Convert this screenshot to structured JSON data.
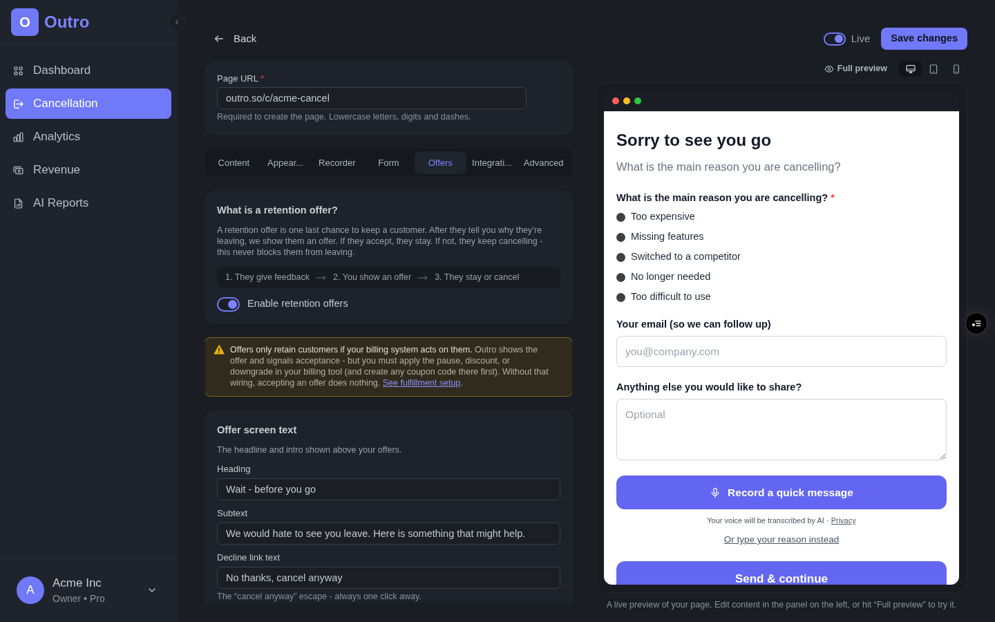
{
  "sidebar": {
    "logo": {
      "mark": "O",
      "name": "Outro"
    },
    "nav_items": [
      {
        "label": "Dashboard",
        "selected": false
      },
      {
        "label": "Cancellation",
        "selected": true
      },
      {
        "label": "Analytics",
        "selected": false
      },
      {
        "label": "Revenue",
        "selected": false
      },
      {
        "label": "AI Reports",
        "selected": false
      }
    ],
    "account": {
      "initial": "A",
      "name": "Acme Inc",
      "subtitle": "Owner • Pro"
    }
  },
  "header": {
    "back": "Back",
    "live_toggle": {
      "label": "Live",
      "on": true
    },
    "save_button": "Save changes"
  },
  "page_url": {
    "label": "Page URL",
    "required_mark": "*",
    "value": "outro.so/c/acme-cancel",
    "hint": "Required to create the page. Lowercase letters, digits and dashes."
  },
  "tabs": [
    {
      "label": "Content",
      "selected": false
    },
    {
      "label": "Appear...",
      "selected": false
    },
    {
      "label": "Recorder",
      "selected": false
    },
    {
      "label": "Form",
      "selected": false
    },
    {
      "label": "Offers",
      "selected": true
    },
    {
      "label": "Integrati...",
      "selected": false
    },
    {
      "label": "Advanced",
      "selected": false
    }
  ],
  "retention_info": {
    "title": "What is a retention offer?",
    "text": "A retention offer is one last chance to keep a customer. After they tell you why they’re leaving, we show them an offer. If they accept, they stay. If not, they keep cancelling - this never blocks them from leaving.",
    "steps": [
      "1. They give feedback",
      "2. You show an offer",
      "3. They stay or cancel"
    ],
    "toggle": {
      "label": "Enable retention offers",
      "on": true
    }
  },
  "warning": {
    "text": "**Offers only retain customers if your billing system acts on them.** Outro shows the offer and signals acceptance - but you must apply the pause, discount, or downgrade in your billing tool (and create any coupon code there first). Without that wiring, accepting an offer does nothing.",
    "link": "See fulfillment setup",
    "text_after": "."
  },
  "offer_screen_text": {
    "title": "Offer screen text",
    "description": "The headline and intro shown above your offers.",
    "fields": [
      {
        "label": "Heading",
        "value": "Wait - before you go"
      },
      {
        "label": "Subtext",
        "value": "We would hate to see you leave. Here is something that might help."
      },
      {
        "label": "Decline link text",
        "value": "No thanks, cancel anyway",
        "hint": "The “cancel anyway” escape - always one click away."
      }
    ]
  },
  "preview": {
    "full_preview": "Full preview",
    "devices": [
      {
        "selected": true
      },
      {
        "selected": false
      },
      {
        "selected": false
      }
    ],
    "page": {
      "title": "Sorry to see you go",
      "subtitle": "What is the main reason you are cancelling?",
      "question": {
        "label": "What is the main reason you are cancelling?",
        "required_mark": "*",
        "options": [
          {
            "label": "Too expensive",
            "selected": false
          },
          {
            "label": "Missing features",
            "selected": false
          },
          {
            "label": "Switched to a competitor",
            "selected": false
          },
          {
            "label": "No longer needed",
            "selected": false
          },
          {
            "label": "Too difficult to use",
            "selected": false
          }
        ]
      },
      "email": {
        "label": "Your email (so we can follow up)",
        "placeholder": "you@company.com"
      },
      "comments": {
        "label": "Anything else you would like to share?",
        "placeholder": "Optional"
      },
      "record_button": "Record a quick message",
      "voice_note": "Your voice will be transcribed by AI ·",
      "privacy_link": "Privacy",
      "type_link": "Or type your reason instead",
      "submit_button": "Send & continue"
    },
    "caption": "A live preview of your page. Edit content in the panel on the left, or hit “Full preview” to try it."
  }
}
